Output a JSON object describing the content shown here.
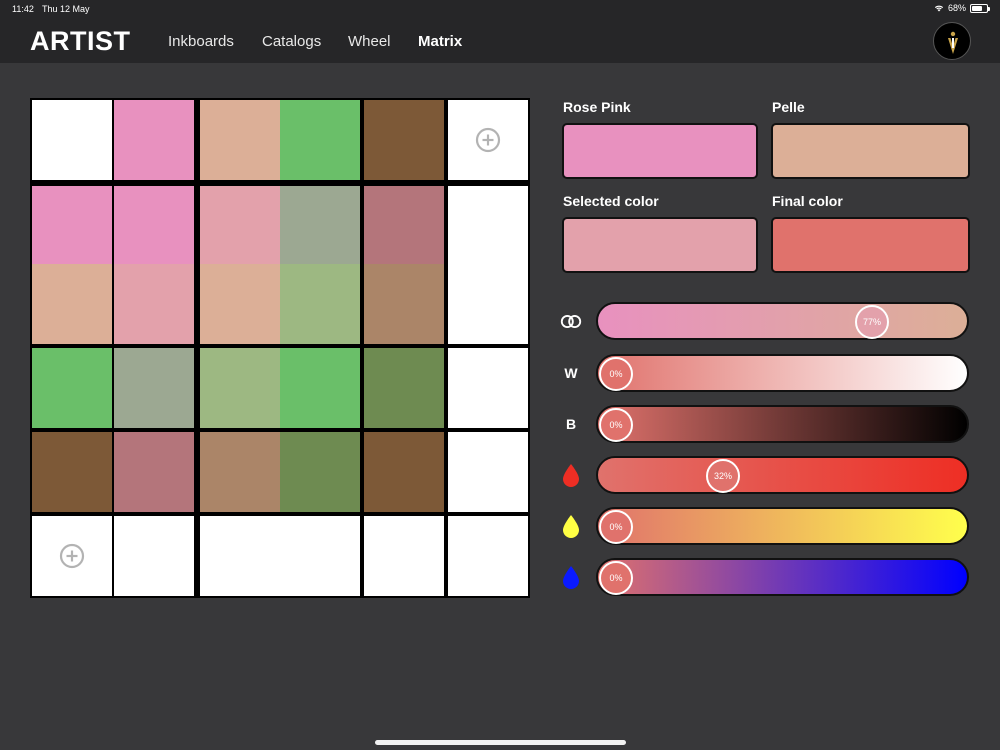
{
  "status_bar": {
    "time": "11:42",
    "date": "Thu 12 May",
    "battery": "68%",
    "battery_level": 0.68
  },
  "header": {
    "logo": "ARTIST",
    "tabs": [
      "Inkboards",
      "Catalogs",
      "Wheel",
      "Matrix"
    ],
    "active_tab": "Matrix",
    "profile_icon": "profile-monogram-icon"
  },
  "matrix": {
    "add_icon": "plus-circle-icon",
    "rows": [
      [
        "#ffffff",
        "#e891bf",
        "#dcaf97",
        "#6abf69",
        "#7d5937",
        "add"
      ],
      [
        "#e891bf",
        "#e891bf",
        "#e3a1ab",
        "#9ca892",
        "#b4757b",
        "#ffffff"
      ],
      [
        "#dcaf97",
        "#e3a1ab",
        "#dcaf97",
        "#9db882",
        "#ab8568",
        "#ffffff"
      ],
      [
        "#6abf69",
        "#9ca892",
        "#9db882",
        "#6abf69",
        "#6e8b51",
        "#ffffff"
      ],
      [
        "#7d5937",
        "#b4757b",
        "#ab8568",
        "#6e8b51",
        "#7d5937",
        "#ffffff"
      ],
      [
        "add",
        "#ffffff",
        "#ffffff",
        "#ffffff",
        "#ffffff",
        "#ffffff"
      ]
    ]
  },
  "swatches": {
    "color_a": {
      "label": "Rose Pink",
      "color": "#e891bf"
    },
    "color_b": {
      "label": "Pelle",
      "color": "#dcaf97"
    },
    "selected": {
      "label": "Selected color",
      "color": "#e3a1ab"
    },
    "final": {
      "label": "Final color",
      "color": "#e0726c"
    }
  },
  "sliders": [
    {
      "id": "mix",
      "icon": "overlapping-rings-icon",
      "value": 0.77,
      "text": "77%",
      "gradient": [
        "#e891bf",
        "#dcaf97"
      ],
      "thumb_color": "#e3a1ab"
    },
    {
      "id": "white",
      "icon": "W",
      "value": 0.0,
      "text": "0%",
      "gradient": [
        "#e0726c",
        "#ffffff"
      ],
      "thumb_color": "#e0726c"
    },
    {
      "id": "black",
      "icon": "B",
      "value": 0.0,
      "text": "0%",
      "gradient": [
        "#e0726c",
        "#000000"
      ],
      "thumb_color": "#e0726c"
    },
    {
      "id": "red",
      "icon": "red-drop-icon",
      "icon_color": "#ee2e24",
      "value": 0.32,
      "text": "32%",
      "gradient": [
        "#e0726c",
        "#ee2e24"
      ],
      "thumb_color": "#e0726c"
    },
    {
      "id": "yellow",
      "icon": "yellow-drop-icon",
      "icon_color": "#ffff44",
      "value": 0.0,
      "text": "0%",
      "gradient": [
        "#e0726c",
        "#ffff4c"
      ],
      "thumb_color": "#e0726c"
    },
    {
      "id": "blue",
      "icon": "blue-drop-icon",
      "icon_color": "#0a1aff",
      "value": 0.0,
      "text": "0%",
      "gradient": [
        "#e0726c",
        "#0000ff"
      ],
      "thumb_color": "#e0726c"
    }
  ]
}
